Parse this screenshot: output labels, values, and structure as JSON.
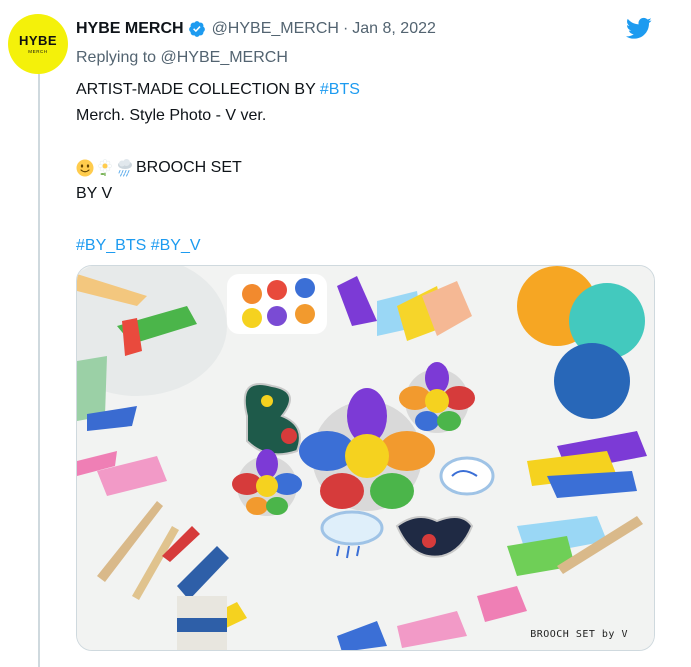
{
  "account": {
    "display_name": "HYBE MERCH",
    "handle": "@HYBE_MERCH",
    "separator": "·",
    "date": "Jan 8, 2022",
    "avatar_main": "HYBE",
    "avatar_sub": "MERCH",
    "avatar_color": "#f4f10a",
    "verified_color": "#1d9bf0"
  },
  "reply": {
    "prefix": "Replying to",
    "mention": "@HYBE_MERCH"
  },
  "tweet": {
    "line1_text": "ARTIST-MADE COLLECTION BY ",
    "line1_tag": "#BTS",
    "line2": "Merch. Style Photo - V ver.",
    "emojis": [
      "slightly-smiling-face-icon",
      "flower-icon",
      "rain-cloud-icon"
    ],
    "line4": "BROOCH SET",
    "line5": "BY V",
    "tag1": "#BY_BTS",
    "tag2": "#BY_V"
  },
  "media": {
    "caption": "BROOCH SET by V"
  },
  "colors": {
    "link": "#1d9bf0",
    "muted": "#536471",
    "twitter_blue": "#1d9bf0"
  },
  "icons": {
    "brand": "twitter-bird-icon",
    "verified": "verified-badge-icon"
  }
}
